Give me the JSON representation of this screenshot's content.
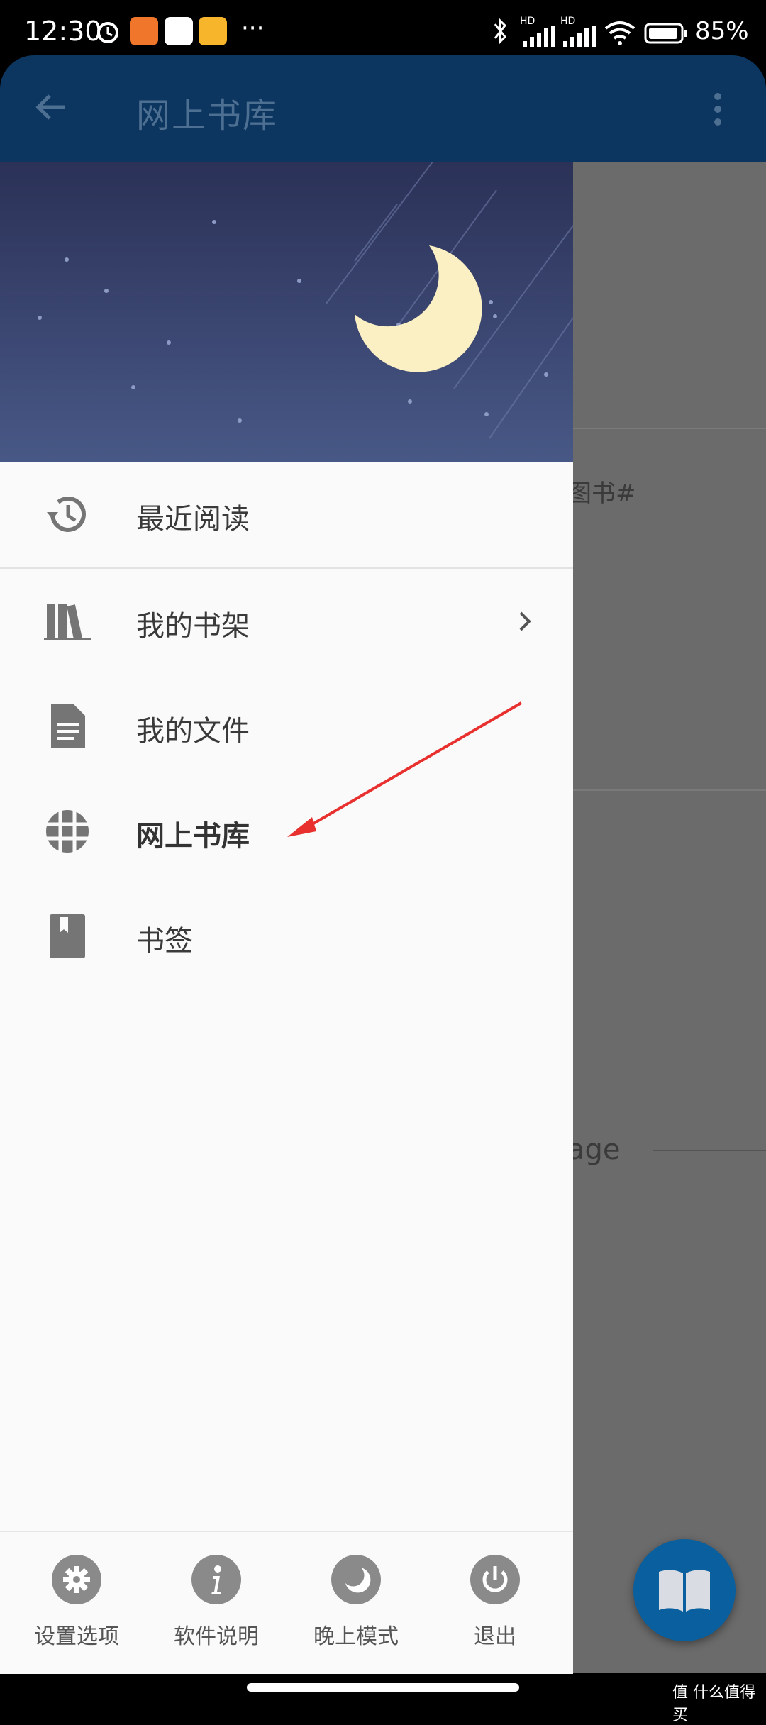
{
  "status_bar": {
    "time": "12:30",
    "battery": "85%",
    "network_labels": [
      "HD",
      "HD"
    ]
  },
  "app_bar": {
    "title": "网上书库",
    "back_icon": "arrow-left-icon",
    "menu_icon": "more-vert-icon"
  },
  "background": {
    "snippet_1": "图书#",
    "snippet_2": "age"
  },
  "drawer": {
    "menu": [
      {
        "label": "最近阅读",
        "icon": "history-icon"
      },
      {
        "label": "我的书架",
        "icon": "bookshelf-icon",
        "has_chevron": true
      },
      {
        "label": "我的文件",
        "icon": "document-icon"
      },
      {
        "label": "网上书库",
        "icon": "globe-grid-icon",
        "active": true
      },
      {
        "label": "书签",
        "icon": "bookmark-icon"
      }
    ],
    "bottom": [
      {
        "label": "设置选项",
        "icon": "gear-icon"
      },
      {
        "label": "软件说明",
        "icon": "info-icon"
      },
      {
        "label": "晚上模式",
        "icon": "moon-icon"
      },
      {
        "label": "退出",
        "icon": "power-icon"
      }
    ]
  },
  "fab": {
    "icon": "open-book-icon"
  },
  "watermark": "值 什么值得买",
  "colors": {
    "app_bar": "#0c365f",
    "drawer_bg": "#fafafa",
    "fab": "#0a5f9e",
    "moon": "#fbf0c4",
    "annotation_arrow": "#e8312f"
  }
}
